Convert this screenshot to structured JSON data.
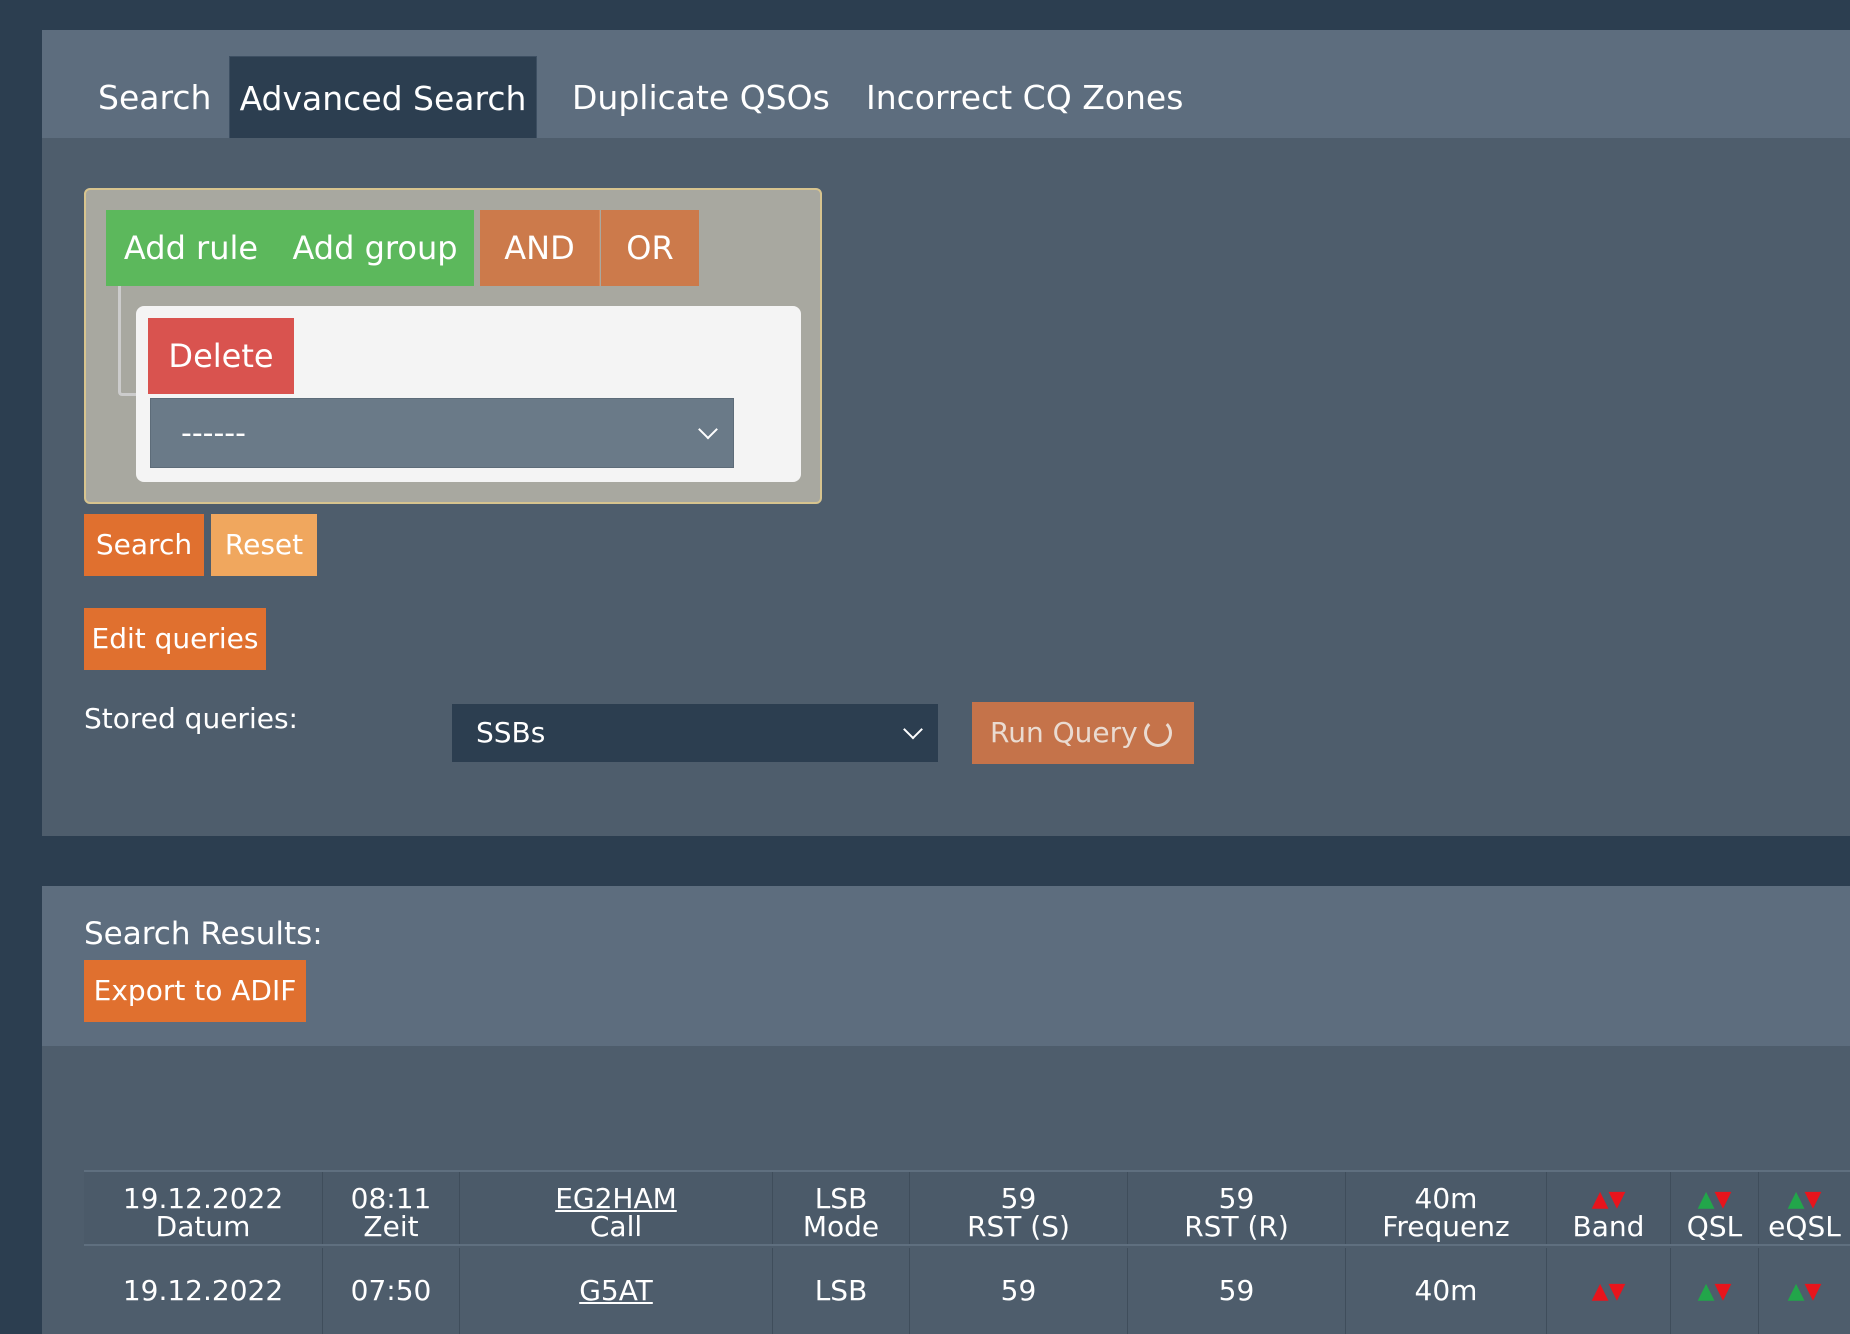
{
  "tabs": [
    "Search",
    "Advanced Search",
    "Duplicate QSOs",
    "Incorrect CQ Zones"
  ],
  "builder": {
    "add_rule": "Add rule",
    "add_group": "Add group",
    "and": "AND",
    "or": "OR",
    "delete": "Delete",
    "field_select": "------"
  },
  "actions": {
    "search": "Search",
    "reset": "Reset",
    "edit_queries": "Edit queries",
    "stored_queries_label": "Stored queries:",
    "stored_query_value": "SSBs",
    "run_query": "Run Query"
  },
  "results": {
    "label": "Search Results:",
    "export": "Export to ADIF",
    "headers": [
      "Datum",
      "Zeit",
      "Call",
      "Mode",
      "RST (S)",
      "RST (R)",
      "Frequenz",
      "Band",
      "QSL",
      "eQSL"
    ],
    "ghost_row": [
      "19.12.2022",
      "08:11",
      "EG2HAM",
      "LSB",
      "59",
      "59",
      "40m"
    ],
    "rows": [
      [
        "19.12.2022",
        "07:50",
        "G5AT",
        "LSB",
        "59",
        "59",
        "40m"
      ]
    ]
  },
  "colors": {
    "background": "#2c3e50",
    "card": "#4e5d6c",
    "green_button": "#5cb85c",
    "orange_button": "#e0702f",
    "danger": "#d9534f",
    "arrow_up_qsl": "#22a64a",
    "arrow_red": "#e8141c"
  },
  "icons": {
    "run_query": "spinner-icon",
    "select": "chevron-down-icon",
    "status_arrows": "up-down-triangle-icon"
  }
}
